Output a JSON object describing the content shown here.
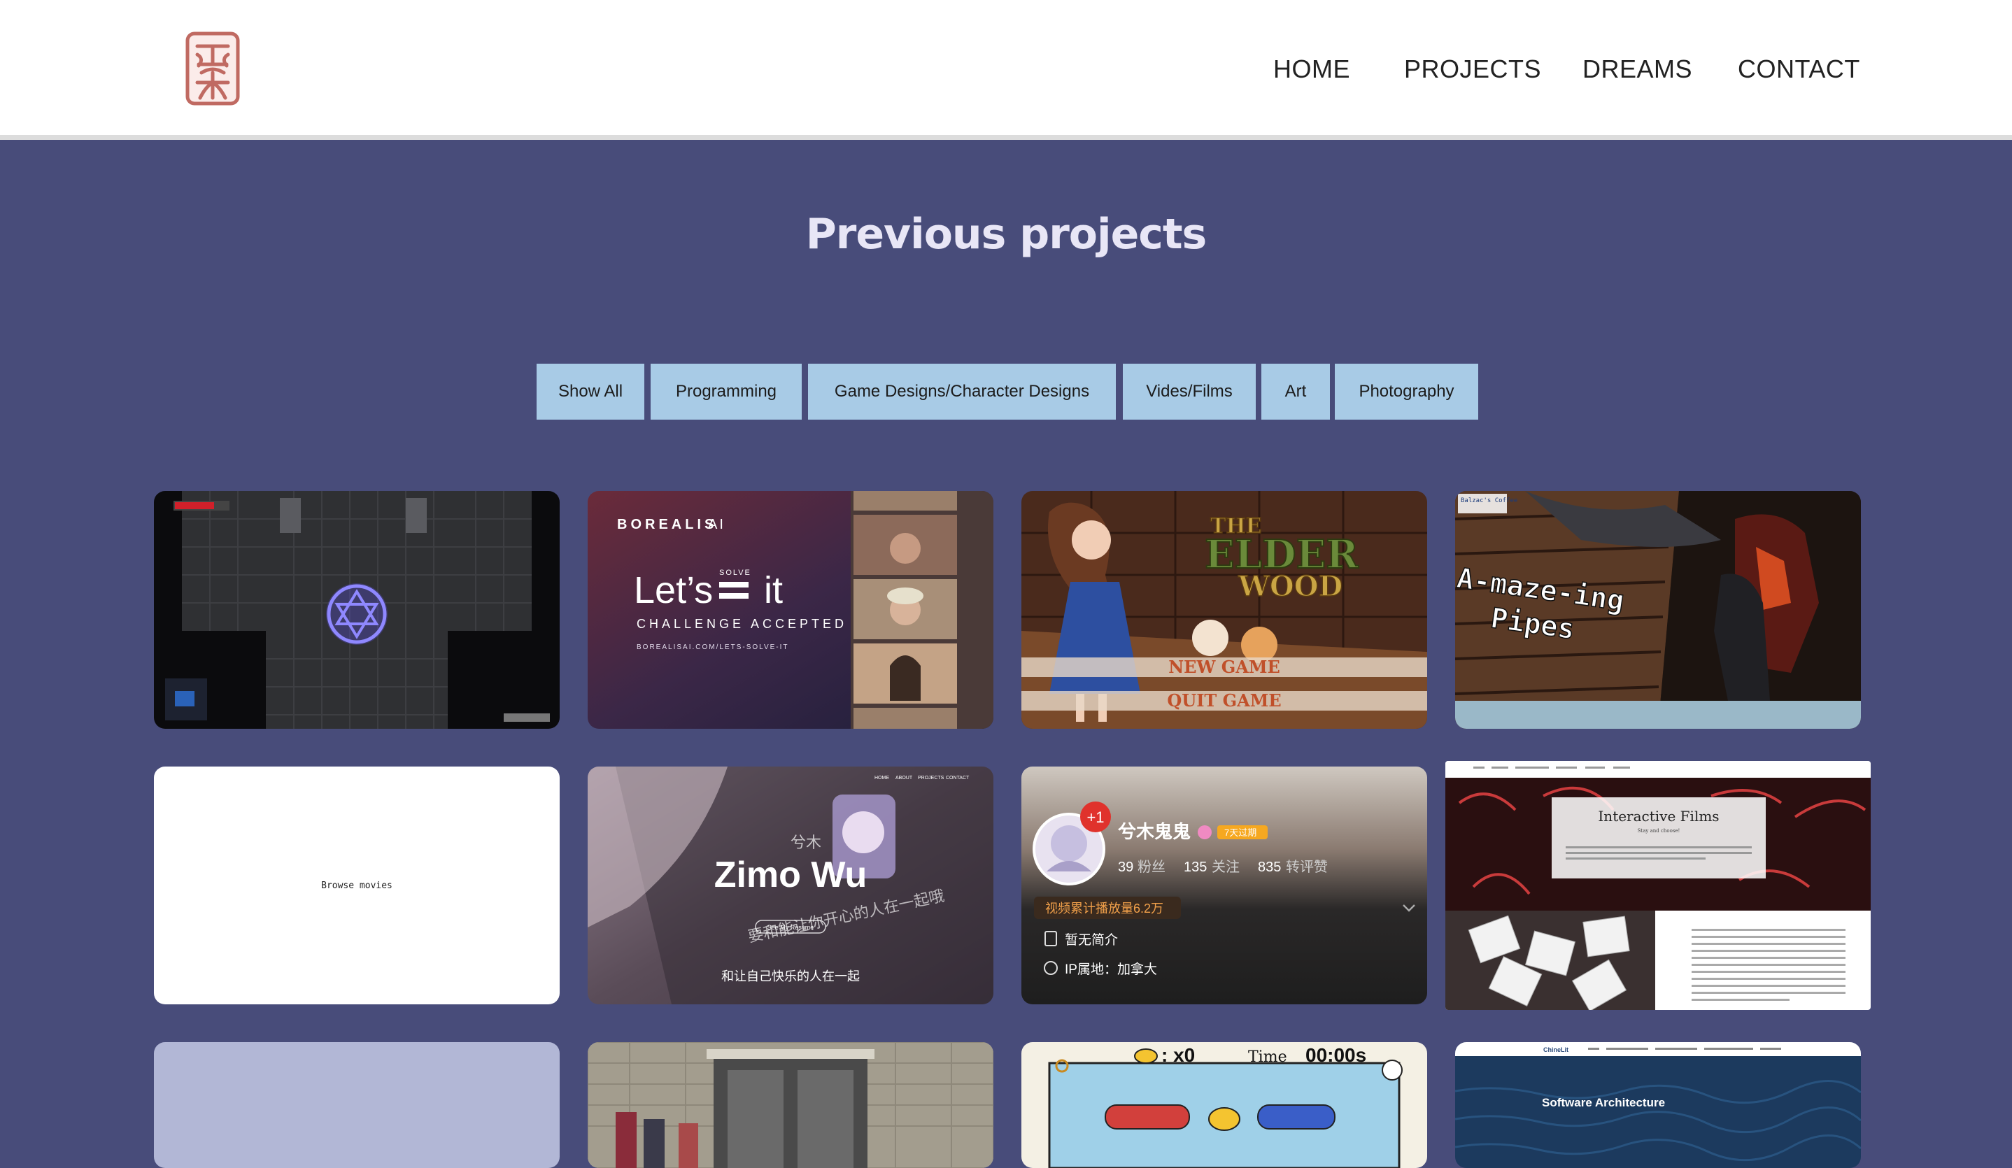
{
  "nav": {
    "items": [
      {
        "label": "HOME"
      },
      {
        "label": "PROJECTS"
      },
      {
        "label": "DREAMS"
      },
      {
        "label": "CONTACT"
      }
    ]
  },
  "section": {
    "title": "Previous projects"
  },
  "filters": [
    "Show All",
    "Programming",
    "Game Designs/Character Designs",
    "Vides/Films",
    "Art",
    "Photography"
  ],
  "cards": {
    "borealis": {
      "brand": "BOREALIS",
      "brand_suffix": "AI",
      "headline_left": "Let’s",
      "headline_solve": "SOLVE",
      "headline_right": "it",
      "sub": "CHALLENGE ACCEPTED",
      "url": "BOREALISAI.COM/LETS-SOLVE-IT"
    },
    "elderwood": {
      "title1": "THE",
      "title2": "ELDER",
      "title3": "WOOD",
      "new_game": "NEW GAME",
      "quit_game": "QUIT GAME"
    },
    "pipes": {
      "corner": "Balzac's Coffee",
      "title1": "A-maze-ing",
      "title2": "Pipes"
    },
    "browse": {
      "text": "Browse movies"
    },
    "zimo": {
      "name": "Zimo Wu",
      "cn_top": "兮木",
      "cn_sub": "要和能让你开心的人在一起哦",
      "cn_bottom": "和让自己快乐的人在一起",
      "button": "See My Resume",
      "nav": [
        "HOME",
        "ABOUT",
        "PROJECTS",
        "CONTACT"
      ]
    },
    "bilibili": {
      "badge": "+1",
      "name": "兮木鬼鬼",
      "vip": "7天过期",
      "fans_num": "39",
      "fans_label": "粉丝",
      "follow_num": "135",
      "follow_label": "关注",
      "likes_num": "835",
      "likes_label": "转评赞",
      "views": "视频累计播放量6.2万",
      "intro": "暂无简介",
      "ip": "IP属地：加拿大"
    },
    "films": {
      "title": "Interactive Films",
      "sub": "Stay and choose!"
    },
    "pool": {
      "ducks": ": x0",
      "time_label": "Time",
      "time_value": "00:00s"
    },
    "software": {
      "heading": "Software Architecture",
      "site": "ChineLit"
    }
  }
}
